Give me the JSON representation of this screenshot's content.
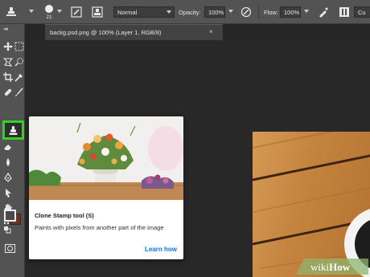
{
  "options_bar": {
    "brush_size": "21",
    "blend_mode": "Normal",
    "opacity_label": "Opacity:",
    "opacity_value": "100%",
    "flow_label": "Flow:",
    "flow_value": "100%",
    "overflow_label": "Cu"
  },
  "toolbar": {
    "collapse_glyph": "◂◂",
    "selected_tool": "clone-stamp-tool",
    "highlight_color": "#2dd61e"
  },
  "document": {
    "tab_label": "backg.psd.png @ 100% (Layer 1, RGB/8)",
    "close_glyph": "×"
  },
  "tooltip": {
    "title": "Clone Stamp tool (S)",
    "description": "Paints with pixels from another part of the image",
    "link": "Learn how",
    "link_color": "#1473e6"
  },
  "watermark": {
    "text_a": "wiki",
    "text_b": "How"
  }
}
